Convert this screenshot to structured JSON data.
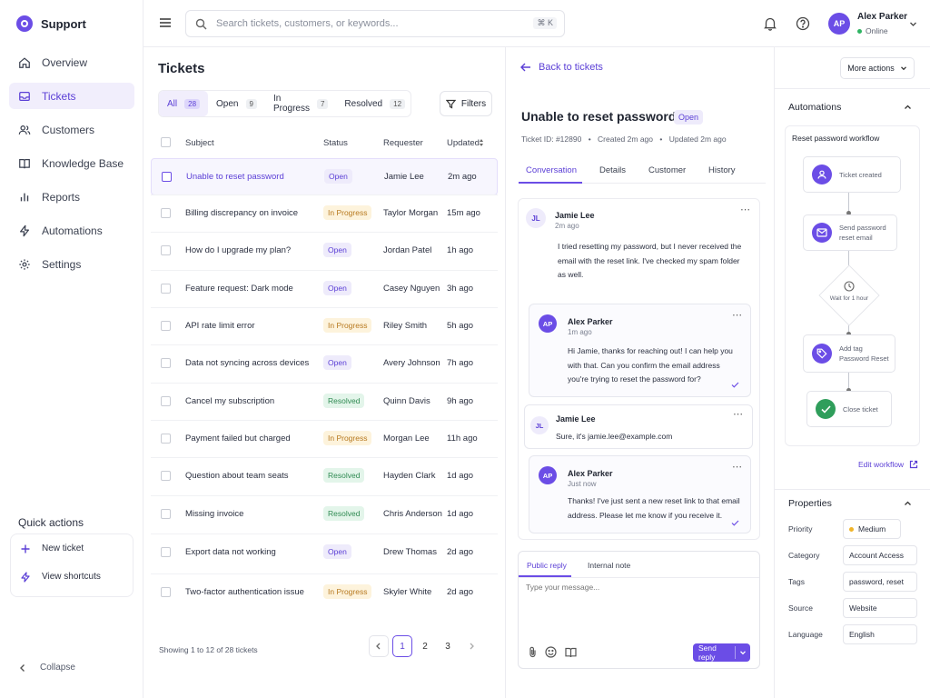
{
  "app": {
    "name": "Support"
  },
  "sidebar": {
    "items": [
      {
        "label": "Overview",
        "icon": "home-icon"
      },
      {
        "label": "Tickets",
        "icon": "inbox-icon",
        "active": true
      },
      {
        "label": "Customers",
        "icon": "users-icon"
      },
      {
        "label": "Knowledge Base",
        "icon": "book-icon"
      },
      {
        "label": "Reports",
        "icon": "bar-chart-icon"
      },
      {
        "label": "Automations",
        "icon": "bolt-icon"
      },
      {
        "label": "Settings",
        "icon": "gear-icon"
      }
    ],
    "quick_actions_title": "Quick actions",
    "quick_actions": [
      {
        "label": "New ticket",
        "icon": "plus-icon"
      },
      {
        "label": "View shortcuts",
        "icon": "bolt-icon"
      }
    ],
    "collapse_label": "Collapse"
  },
  "header": {
    "search_placeholder": "Search tickets, customers, or keywords...",
    "search_shortcut": "⌘ K",
    "user": {
      "initials": "AP",
      "name": "Alex Parker",
      "status": "Online"
    }
  },
  "tickets": {
    "title": "Tickets",
    "tabs": [
      {
        "label": "All",
        "count": "28",
        "active": true
      },
      {
        "label": "Open",
        "count": "9"
      },
      {
        "label": "In Progress",
        "count": "7"
      },
      {
        "label": "Resolved",
        "count": "12"
      }
    ],
    "filters_label": "Filters",
    "columns": {
      "subject": "Subject",
      "status": "Status",
      "requester": "Requester",
      "updated": "Updated"
    },
    "rows": [
      {
        "subject": "Unable to reset password",
        "status": "Open",
        "requester": "Jamie Lee",
        "updated": "2m ago"
      },
      {
        "subject": "Billing discrepancy on invoice",
        "status": "In Progress",
        "requester": "Taylor Morgan",
        "updated": "15m ago"
      },
      {
        "subject": "How do I upgrade my plan?",
        "status": "Open",
        "requester": "Jordan Patel",
        "updated": "1h ago"
      },
      {
        "subject": "Feature request: Dark mode",
        "status": "Open",
        "requester": "Casey Nguyen",
        "updated": "3h ago"
      },
      {
        "subject": "API rate limit error",
        "status": "In Progress",
        "requester": "Riley Smith",
        "updated": "5h ago"
      },
      {
        "subject": "Data not syncing across devices",
        "status": "Open",
        "requester": "Avery Johnson",
        "updated": "7h ago"
      },
      {
        "subject": "Cancel my subscription",
        "status": "Resolved",
        "requester": "Quinn Davis",
        "updated": "9h ago"
      },
      {
        "subject": "Payment failed but charged",
        "status": "In Progress",
        "requester": "Morgan Lee",
        "updated": "11h ago"
      },
      {
        "subject": "Question about team seats",
        "status": "Resolved",
        "requester": "Hayden Clark",
        "updated": "1d ago"
      },
      {
        "subject": "Missing invoice",
        "status": "Resolved",
        "requester": "Chris Anderson",
        "updated": "1d ago"
      },
      {
        "subject": "Export data not working",
        "status": "Open",
        "requester": "Drew Thomas",
        "updated": "2d ago"
      },
      {
        "subject": "Two-factor authentication issue",
        "status": "In Progress",
        "requester": "Skyler White",
        "updated": "2d ago"
      }
    ],
    "footer": "Showing 1 to 12 of 28 tickets",
    "pages": [
      "1",
      "2",
      "3"
    ]
  },
  "detail": {
    "back_label": "Back to tickets",
    "more_actions": "More actions",
    "title": "Unable to reset password",
    "status": "Open",
    "ticket_id": "Ticket ID: #12890",
    "created": "Created 2m ago",
    "updated": "Updated 2m ago",
    "tabs": [
      "Conversation",
      "Details",
      "Customer",
      "History"
    ],
    "messages": [
      {
        "initials": "JL",
        "name": "Jamie Lee",
        "time": "2m ago",
        "lines": [
          "I tried resetting my password, but I never received the",
          "email with the reset link. I've checked my spam folder",
          "as well."
        ]
      },
      {
        "initials": "AP",
        "name": "Alex Parker",
        "time": "1m ago",
        "lines": [
          "Hi Jamie, thanks for reaching out! I can help you",
          "with that. Can you confirm the email address",
          "you're trying to reset the password for?"
        ]
      },
      {
        "initials": "JL",
        "name": "Jamie Lee",
        "time": "",
        "lines": [
          "Sure, it's jamie.lee@example.com"
        ]
      },
      {
        "initials": "AP",
        "name": "Alex Parker",
        "time": "Just now",
        "lines": [
          "Thanks! I've just sent a new reset link to that email",
          "address. Please let me know if you receive it."
        ]
      }
    ],
    "reply": {
      "tab_public": "Public reply",
      "tab_internal": "Internal note",
      "placeholder": "Type your message...",
      "send": "Send reply"
    }
  },
  "automations": {
    "title": "Automations",
    "workflow_name": "Reset password workflow",
    "nodes": [
      {
        "label": "Ticket created",
        "icon": "user-icon"
      },
      {
        "label": "Send password reset email",
        "lines": [
          "Send password",
          "reset email"
        ],
        "icon": "mail-icon"
      },
      {
        "label": "Wait for 1 hour",
        "icon": "clock-icon"
      },
      {
        "label": "Add tag Password Reset",
        "lines": [
          "Add tag",
          "Password Reset"
        ],
        "icon": "tag-icon"
      },
      {
        "label": "Close ticket",
        "icon": "check-icon"
      }
    ],
    "edit_label": "Edit workflow"
  },
  "properties": {
    "title": "Properties",
    "items": [
      {
        "label": "Priority",
        "value": "Medium"
      },
      {
        "label": "Category",
        "value": "Account Access"
      },
      {
        "label": "Tags",
        "value": "password, reset"
      },
      {
        "label": "Source",
        "value": "Website"
      },
      {
        "label": "Language",
        "value": "English"
      }
    ]
  },
  "colors": {
    "accent": "#6b4de6",
    "open": "#5b3fd6",
    "in_progress": "#b7791f",
    "resolved": "#2f8a52",
    "priority_medium": "#f0b429"
  }
}
